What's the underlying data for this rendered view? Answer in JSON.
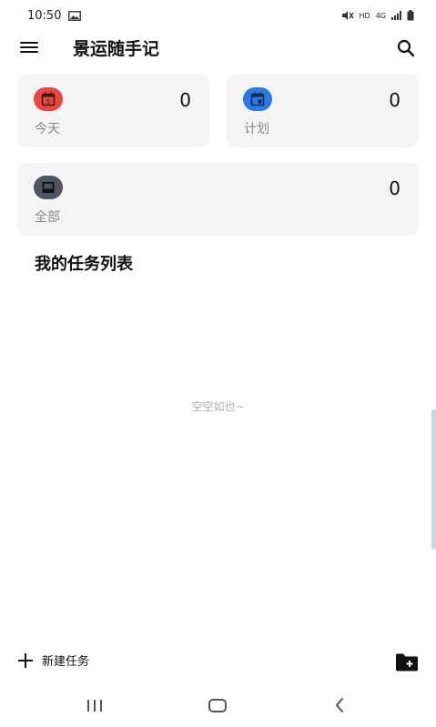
{
  "status_bar": {
    "time": "10:50",
    "network_label": "HD",
    "signal_label": "4G",
    "icons": [
      "image-icon",
      "mute-icon",
      "signal-icon",
      "battery-icon"
    ]
  },
  "app_bar": {
    "title": "景运随手记",
    "icons": [
      "menu-icon",
      "search-icon"
    ]
  },
  "cards": {
    "today": {
      "label": "今天",
      "count": "0",
      "icon_day": "5",
      "color": "#e8483e"
    },
    "plan": {
      "label": "计划",
      "count": "0",
      "color": "#2979e6"
    },
    "all": {
      "label": "全部",
      "count": "0",
      "color": "#4d5562"
    }
  },
  "section": {
    "title": "我的任务列表",
    "empty_text": "空空如也~"
  },
  "actions": {
    "new_task_label": "新建任务",
    "icons": [
      "plus-icon",
      "new-folder-icon"
    ]
  },
  "nav_bar": {
    "icons": [
      "recent-apps-icon",
      "home-icon",
      "back-icon"
    ]
  },
  "colors": {
    "card_bg": "#f4f4f5",
    "muted_text": "#8a8a8a",
    "empty_text": "#b0b0b0"
  }
}
